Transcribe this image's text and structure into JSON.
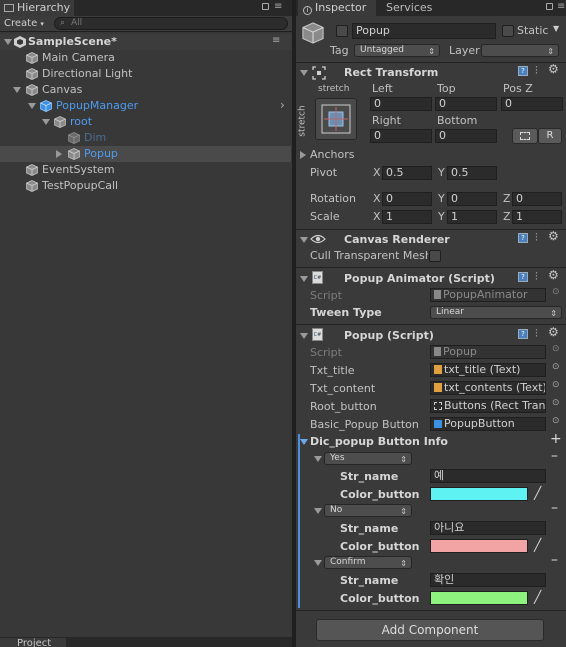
{
  "hierarchy": {
    "tab_label": "Hierarchy",
    "create_label": "Create",
    "search_placeholder": "All",
    "scene_name": "SampleScene*",
    "items": [
      {
        "label": "Main Camera"
      },
      {
        "label": "Directional Light"
      },
      {
        "label": "Canvas"
      },
      {
        "label": "PopupManager"
      },
      {
        "label": "root"
      },
      {
        "label": "Dim"
      },
      {
        "label": "Popup"
      },
      {
        "label": "EventSystem"
      },
      {
        "label": "TestPopupCall"
      }
    ],
    "bottom_tab": "Project"
  },
  "inspector": {
    "tab_label": "Inspector",
    "services_tab": "Services",
    "object_name": "Popup",
    "static_label": "Static",
    "tag_label": "Tag",
    "tag_value": "Untagged",
    "layer_label": "Layer",
    "layer_value": "",
    "rect_transform": {
      "title": "Rect Transform",
      "stretch_top": "stretch",
      "stretch_side": "stretch",
      "left_label": "Left",
      "left_value": "0",
      "top_label": "Top",
      "top_value": "0",
      "posz_label": "Pos Z",
      "posz_value": "0",
      "right_label": "Right",
      "right_value": "0",
      "bottom_label": "Bottom",
      "bottom_value": "0",
      "r_button": "R",
      "anchors_label": "Anchors",
      "pivot_label": "Pivot",
      "pivot_x_label": "X",
      "pivot_x": "0.5",
      "pivot_y_label": "Y",
      "pivot_y": "0.5",
      "rotation_label": "Rotation",
      "rot_x_label": "X",
      "rot_x": "0",
      "rot_y_label": "Y",
      "rot_y": "0",
      "rot_z_label": "Z",
      "rot_z": "0",
      "scale_label": "Scale",
      "scale_x_label": "X",
      "scale_x": "1",
      "scale_y_label": "Y",
      "scale_y": "1",
      "scale_z_label": "Z",
      "scale_z": "1"
    },
    "canvas_renderer": {
      "title": "Canvas Renderer",
      "cull_label": "Cull Transparent Mesh"
    },
    "popup_animator": {
      "title": "Popup Animator (Script)",
      "script_label": "Script",
      "script_value": "PopupAnimator",
      "tween_label": "Tween Type",
      "tween_value": "Linear"
    },
    "popup_script": {
      "title": "Popup (Script)",
      "script_label": "Script",
      "script_value": "Popup",
      "fields": [
        {
          "label": "Txt_title",
          "value": "txt_title (Text)"
        },
        {
          "label": "Txt_content",
          "value": "txt_contents (Text)"
        },
        {
          "label": "Root_button",
          "value": "Buttons (Rect Transform)"
        },
        {
          "label": "Basic_Popup Button",
          "value": "PopupButton"
        }
      ],
      "dic_label": "Dic_popup Button Info",
      "entries": [
        {
          "key": "Yes",
          "str_label": "Str_name",
          "str_value": "예",
          "color_label": "Color_button",
          "color": "#5ef2f2"
        },
        {
          "key": "No",
          "str_label": "Str_name",
          "str_value": "아니요",
          "color_label": "Color_button",
          "color": "#f2a4a4"
        },
        {
          "key": "Confirm",
          "str_label": "Str_name",
          "str_value": "확인",
          "color_label": "Color_button",
          "color": "#8ef27e"
        }
      ]
    },
    "add_component": "Add Component"
  }
}
